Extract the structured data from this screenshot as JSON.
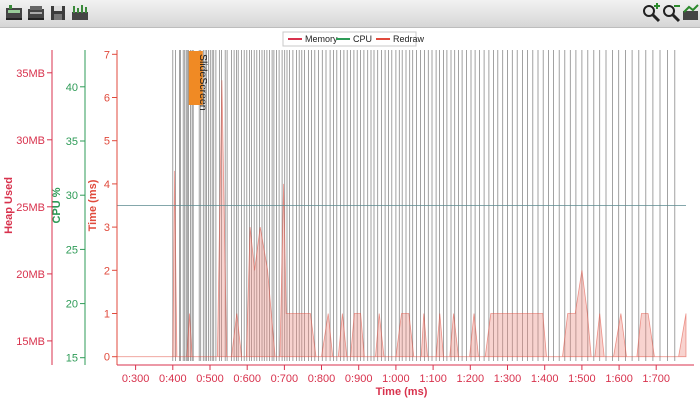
{
  "toolbar": {
    "left_icons": [
      "memory-snapshot-icon",
      "cpu-snapshot-icon",
      "save-icon",
      "frames-icon"
    ],
    "right_icons": [
      "zoom-in-icon",
      "zoom-out-icon",
      "reset-zoom-icon"
    ]
  },
  "chart_data": {
    "type": "area",
    "legend": {
      "placement": "top",
      "entries": [
        {
          "name": "Memory",
          "color": "#d8324d"
        },
        {
          "name": "CPU",
          "color": "#2e9b57"
        },
        {
          "name": "Redraw",
          "color": "#e04a3c"
        }
      ]
    },
    "xlabel": "Time (ms)",
    "x_ticks": [
      "0:300",
      "0:400",
      "0:500",
      "0:600",
      "0:700",
      "0:800",
      "0:900",
      "1:000",
      "1:100",
      "1:200",
      "1:300",
      "1:400",
      "1:500",
      "1:600",
      "1:700"
    ],
    "xlim": [
      250,
      1780
    ],
    "axes": {
      "memory": {
        "label": "Heap Used",
        "color": "#d8324d",
        "ticks": [
          "15MB",
          "20MB",
          "25MB",
          "30MB",
          "35MB"
        ],
        "ylim": [
          13.5,
          36.7
        ]
      },
      "cpu": {
        "label": "CPU %",
        "color": "#2e9b57",
        "ticks": [
          "15",
          "20",
          "25",
          "30",
          "35",
          "40"
        ],
        "ylim": [
          14.7,
          43.4
        ]
      },
      "redraw": {
        "label": "Time (ms)",
        "color": "#e04a3c",
        "ticks": [
          "0",
          "1",
          "2",
          "3",
          "4",
          "5",
          "6",
          "7"
        ],
        "ylim": [
          -0.1,
          7.1
        ]
      }
    },
    "threshold_line": {
      "axis": "redraw",
      "value": 3.5,
      "color": "#5b8a8f"
    },
    "annotation": {
      "text": "SlideScreen",
      "x": 462,
      "color": "#f08a24"
    },
    "redraw_series": {
      "name": "Redraw",
      "points": [
        [
          250,
          0
        ],
        [
          400,
          0
        ],
        [
          405,
          4.3
        ],
        [
          411,
          0
        ],
        [
          438,
          0
        ],
        [
          445,
          1
        ],
        [
          452,
          0
        ],
        [
          520,
          0
        ],
        [
          532,
          6.4
        ],
        [
          545,
          0
        ],
        [
          558,
          0
        ],
        [
          572,
          1
        ],
        [
          585,
          0
        ],
        [
          598,
          0
        ],
        [
          608,
          3
        ],
        [
          620,
          2
        ],
        [
          635,
          3
        ],
        [
          655,
          2
        ],
        [
          665,
          1
        ],
        [
          675,
          0
        ],
        [
          688,
          0
        ],
        [
          698,
          4
        ],
        [
          705,
          1
        ],
        [
          718,
          1
        ],
        [
          770,
          1
        ],
        [
          785,
          0
        ],
        [
          800,
          0
        ],
        [
          818,
          1
        ],
        [
          830,
          0
        ],
        [
          845,
          0
        ],
        [
          856,
          1
        ],
        [
          868,
          0
        ],
        [
          878,
          0
        ],
        [
          888,
          1
        ],
        [
          905,
          1
        ],
        [
          915,
          0
        ],
        [
          930,
          0
        ],
        [
          945,
          0
        ],
        [
          955,
          1
        ],
        [
          968,
          0
        ],
        [
          1000,
          0
        ],
        [
          1015,
          1
        ],
        [
          1035,
          1
        ],
        [
          1048,
          0
        ],
        [
          1068,
          0
        ],
        [
          1075,
          1
        ],
        [
          1085,
          0
        ],
        [
          1108,
          0
        ],
        [
          1118,
          1
        ],
        [
          1128,
          0
        ],
        [
          1145,
          0
        ],
        [
          1155,
          1
        ],
        [
          1168,
          0
        ],
        [
          1198,
          0
        ],
        [
          1210,
          1
        ],
        [
          1222,
          0
        ],
        [
          1240,
          0
        ],
        [
          1255,
          1
        ],
        [
          1395,
          1
        ],
        [
          1405,
          0
        ],
        [
          1448,
          0
        ],
        [
          1462,
          1
        ],
        [
          1482,
          1
        ],
        [
          1500,
          2
        ],
        [
          1515,
          1
        ],
        [
          1525,
          0
        ],
        [
          1535,
          0
        ],
        [
          1548,
          1
        ],
        [
          1560,
          0
        ],
        [
          1585,
          0
        ],
        [
          1605,
          1
        ],
        [
          1620,
          0
        ],
        [
          1648,
          0
        ],
        [
          1660,
          1
        ],
        [
          1678,
          1
        ],
        [
          1695,
          0
        ],
        [
          1760,
          0
        ],
        [
          1780,
          1
        ]
      ]
    },
    "frame_marks_x": [
      400,
      407,
      418,
      421,
      428,
      432,
      436,
      439,
      442,
      448,
      452,
      455,
      471,
      475,
      482,
      487,
      491,
      496,
      501,
      506,
      510,
      516,
      526,
      531,
      541,
      546,
      558,
      565,
      571,
      576,
      585,
      592,
      599,
      606,
      612,
      619,
      626,
      633,
      640,
      646,
      653,
      660,
      667,
      672,
      679,
      686,
      694,
      701,
      707,
      714,
      723,
      733,
      740,
      747,
      754,
      765,
      773,
      782,
      792,
      802,
      812,
      823,
      832,
      841,
      851,
      860,
      869,
      878,
      887,
      896,
      905,
      914,
      924,
      933,
      941,
      951,
      961,
      971,
      980,
      989,
      1000,
      1009,
      1017,
      1027,
      1037,
      1045,
      1055,
      1066,
      1077,
      1087,
      1097,
      1108,
      1117,
      1128,
      1137,
      1148,
      1158,
      1168,
      1178,
      1190,
      1202,
      1213,
      1225,
      1237,
      1250,
      1262,
      1274,
      1287,
      1300,
      1313,
      1326,
      1340,
      1354,
      1368,
      1382,
      1396,
      1410,
      1424,
      1439,
      1454,
      1469,
      1484,
      1500,
      1516,
      1532,
      1548,
      1565,
      1582,
      1599,
      1617,
      1635,
      1653,
      1672,
      1691,
      1710,
      1730,
      1750
    ]
  }
}
